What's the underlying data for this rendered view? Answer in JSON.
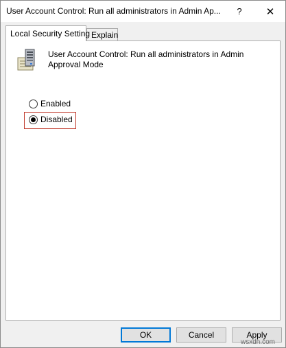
{
  "window": {
    "title": "User Account Control: Run all administrators in Admin Ap...",
    "help_symbol": "?",
    "close_symbol": "✕"
  },
  "tabs": [
    {
      "label": "Local Security Setting",
      "active": true
    },
    {
      "label": "Explain",
      "active": false
    }
  ],
  "policy": {
    "icon": "server-policy-icon",
    "title": "User Account Control: Run all administrators in Admin Approval Mode"
  },
  "options": [
    {
      "label": "Enabled",
      "selected": false
    },
    {
      "label": "Disabled",
      "selected": true
    }
  ],
  "buttons": {
    "ok": "OK",
    "cancel": "Cancel",
    "apply": "Apply"
  },
  "watermark": "wsxdn.com",
  "colors": {
    "highlight": "#c0392b",
    "focus_border": "#0078d7"
  }
}
